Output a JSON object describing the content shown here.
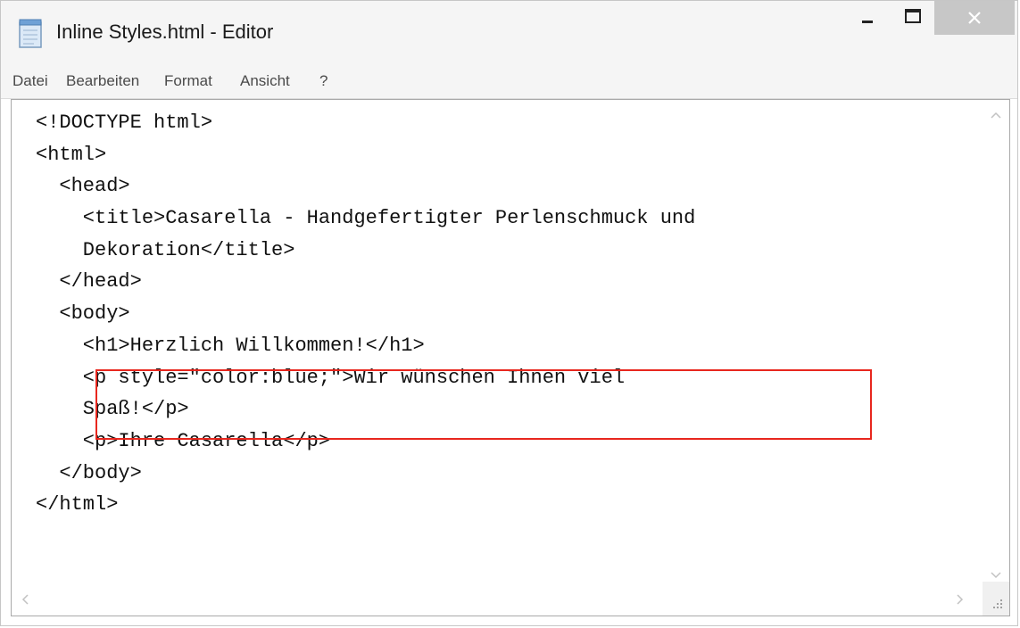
{
  "window": {
    "title": "Inline Styles.html - Editor"
  },
  "menu": [
    {
      "label": "Datei"
    },
    {
      "label": "Bearbeiten"
    },
    {
      "label": "Format"
    },
    {
      "label": "Ansicht"
    },
    {
      "label": "?"
    }
  ],
  "editor": {
    "lines": [
      "<!DOCTYPE html>",
      "<html>",
      "  <head>",
      "    <title>Casarella - Handgefertigter Perlenschmuck und",
      "    Dekoration</title>",
      "  </head>",
      "  <body>",
      "    <h1>Herzlich Willkommen!</h1>",
      "    <p style=\"color:blue;\">Wir wünschen Ihnen viel",
      "    Spaß!</p>",
      "    <p>Ihre Casarella</p>",
      "  </body>",
      "</html>"
    ]
  },
  "colors": {
    "highlight": "#e8271e",
    "close_button": "#c7c7c7"
  },
  "icons": {
    "app": "notepad-icon",
    "minimize": "minimize-icon",
    "maximize": "maximize-icon",
    "close": "close-icon"
  }
}
